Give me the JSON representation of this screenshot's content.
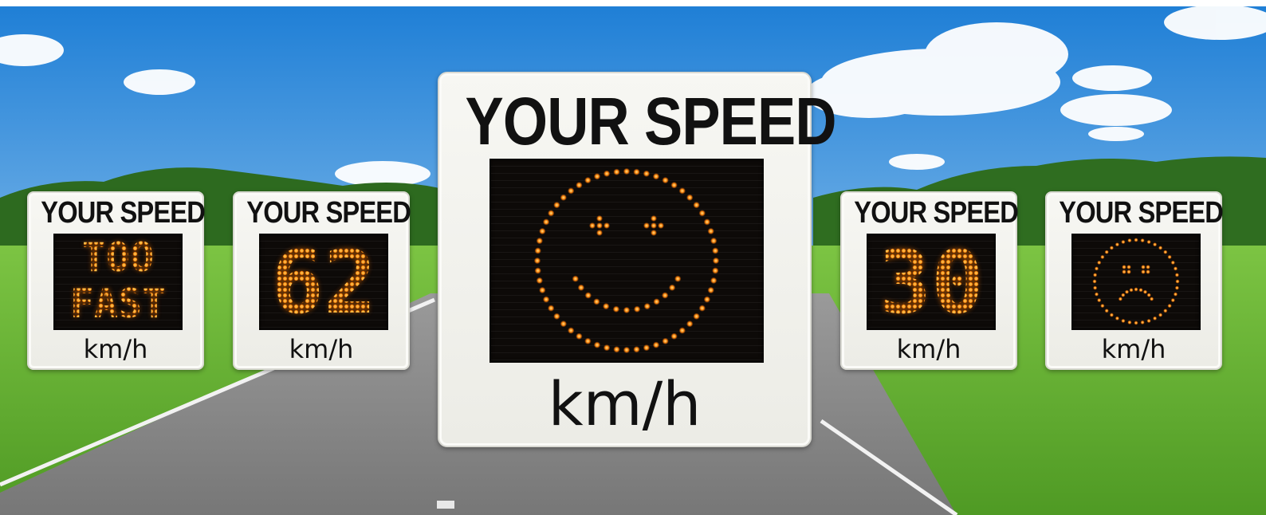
{
  "signs": [
    {
      "title": "YOUR SPEED",
      "display_lines": [
        "TOO",
        "FAST"
      ],
      "unit": "km/h",
      "face": "none"
    },
    {
      "title": "YOUR SPEED",
      "display_lines": [
        "62"
      ],
      "unit": "km/h",
      "face": "none"
    },
    {
      "title": "YOUR SPEED",
      "display_lines": [],
      "unit": "km/h",
      "face": "smiley-face-icon"
    },
    {
      "title": "YOUR SPEED",
      "display_lines": [
        "30"
      ],
      "unit": "km/h",
      "face": "none"
    },
    {
      "title": "YOUR SPEED",
      "display_lines": [],
      "unit": "km/h",
      "face": "sad-face-icon"
    }
  ],
  "colors": {
    "sky_top": "#1f7fd6",
    "sky_bottom": "#bfe0f7",
    "grass": "#5fae2e",
    "road": "#8c8c8c",
    "led": "#ff8a10",
    "sign_face": "#f4f4f0"
  }
}
